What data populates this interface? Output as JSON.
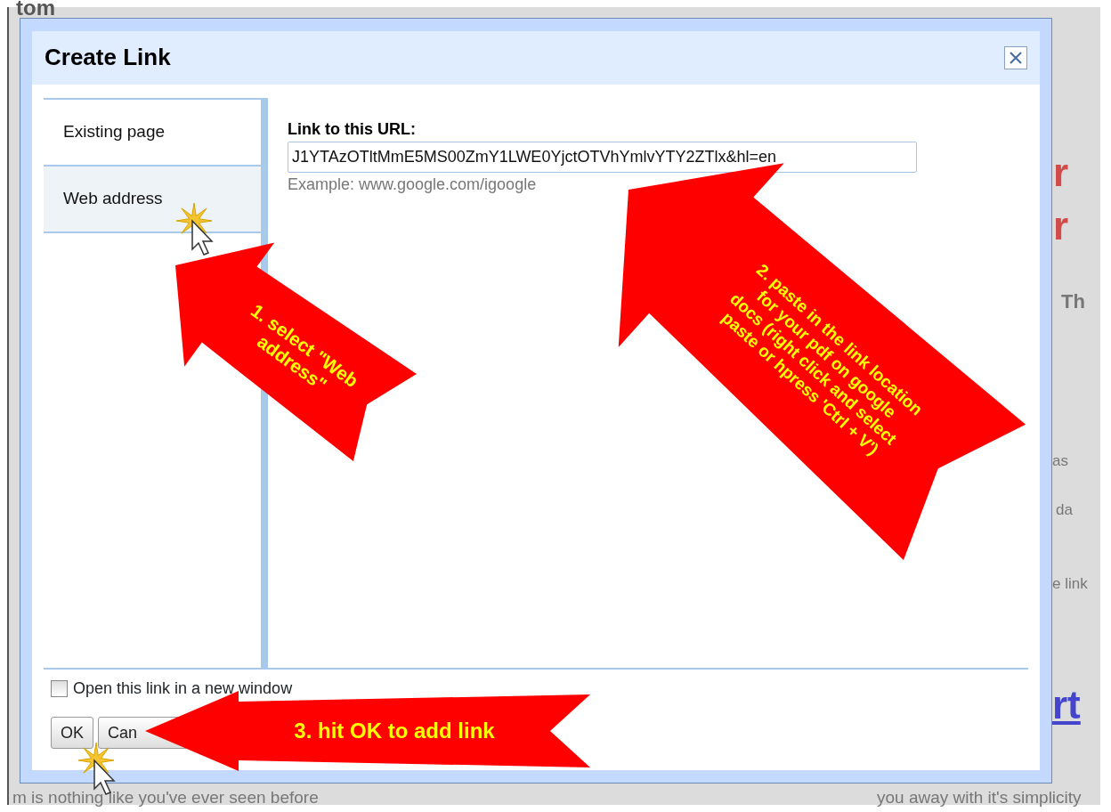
{
  "background_page": {
    "heading_fragment": "tom",
    "right_fragments": [
      {
        "text": "r",
        "kind": "heading"
      },
      {
        "text": "r",
        "kind": "heading"
      },
      {
        "text": "Th",
        "kind": "subheading"
      },
      {
        "text": "as",
        "kind": "body"
      },
      {
        "text": "da",
        "kind": "body"
      },
      {
        "text": "e link",
        "kind": "body"
      },
      {
        "text": "rt",
        "kind": "link"
      }
    ],
    "bottom_fragments": [
      "m is nothing like you've ever seen before",
      "you away with it's simplicity"
    ]
  },
  "dialog": {
    "title": "Create Link",
    "tabs": [
      {
        "label": "Existing page",
        "selected": false
      },
      {
        "label": "Web address",
        "selected": true
      }
    ],
    "url_field": {
      "label": "Link to this URL:",
      "value": "J1YTAzOTltMmE5MS00ZmY1LWE0YjctOTVhYmlvYTY2ZTlx&hl=en",
      "hint": "Example: www.google.com/igoogle"
    },
    "new_window_checkbox": {
      "label": "Open this link in a new window",
      "checked": false
    },
    "buttons": [
      "OK",
      "Can"
    ]
  },
  "annotations": [
    {
      "lines": [
        "1. select \"Web",
        "address\""
      ]
    },
    {
      "lines": [
        "2. paste in the link location",
        "for your pdf on google",
        "docs (right click and select",
        "paste or hpress 'Ctrl + V')"
      ]
    },
    {
      "lines": [
        "3. hit OK to add link"
      ]
    }
  ]
}
